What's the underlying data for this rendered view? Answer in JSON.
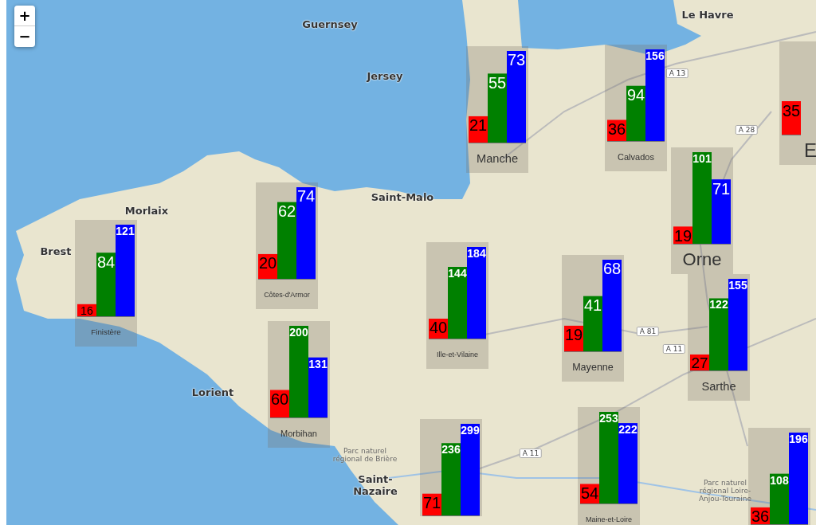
{
  "zoom_controls": [
    {
      "label": "+"
    },
    {
      "label": "−"
    }
  ],
  "places": [
    {
      "kind": "city",
      "name": "Guernsey"
    },
    {
      "kind": "city",
      "name": "Jersey"
    },
    {
      "kind": "city",
      "name": "Le Havre"
    },
    {
      "kind": "city",
      "name": "Saint-Malo"
    },
    {
      "kind": "city",
      "name": "Morlaix"
    },
    {
      "kind": "city",
      "name": "Brest"
    },
    {
      "kind": "city",
      "name": "Lorient"
    },
    {
      "kind": "park",
      "name": "Parc naturel régional de Brière"
    },
    {
      "kind": "city",
      "name": "Saint-Nazaire"
    },
    {
      "kind": "park",
      "name": "Parc naturel régional Loire-Anjou-Touraine"
    },
    {
      "kind": "road",
      "name": "A 13"
    },
    {
      "kind": "road",
      "name": "A 28"
    },
    {
      "kind": "road",
      "name": "A 81"
    },
    {
      "kind": "road",
      "name": "A 11"
    },
    {
      "kind": "road",
      "name": "A 11"
    }
  ],
  "markers": [
    {
      "label": "Manche",
      "chart_data": {
        "type": "bar",
        "categories": [
          null
        ],
        "data_labels": true,
        "series": [
          {
            "color": "#ff0000",
            "values": [
              21
            ]
          },
          {
            "color": "#008000",
            "values": [
              55
            ]
          },
          {
            "color": "#0000ff",
            "values": [
              73
            ]
          }
        ]
      }
    },
    {
      "label": "Calvados",
      "chart_data": {
        "type": "bar",
        "categories": [
          null
        ],
        "data_labels": true,
        "series": [
          {
            "color": "#ff0000",
            "values": [
              36
            ]
          },
          {
            "color": "#008000",
            "values": [
              94
            ]
          },
          {
            "color": "#0000ff",
            "values": [
              156
            ]
          }
        ]
      }
    },
    {
      "label": "E",
      "partial_bar": {
        "value": "35",
        "color": "#ff0000"
      }
    },
    {
      "label": "Orne",
      "chart_data": {
        "type": "bar",
        "categories": [
          null
        ],
        "data_labels": true,
        "series": [
          {
            "color": "#ff0000",
            "values": [
              19
            ]
          },
          {
            "color": "#008000",
            "values": [
              101
            ]
          },
          {
            "color": "#0000ff",
            "values": [
              71
            ]
          }
        ]
      }
    },
    {
      "label": "Côtes-d'Armor",
      "chart_data": {
        "type": "bar",
        "categories": [
          null
        ],
        "data_labels": true,
        "series": [
          {
            "color": "#ff0000",
            "values": [
              20
            ]
          },
          {
            "color": "#008000",
            "values": [
              62
            ]
          },
          {
            "color": "#0000ff",
            "values": [
              74
            ]
          }
        ]
      }
    },
    {
      "label": "Finistère",
      "chart_data": {
        "type": "bar",
        "categories": [
          null
        ],
        "data_labels": true,
        "series": [
          {
            "color": "#ff0000",
            "values": [
              16
            ]
          },
          {
            "color": "#008000",
            "values": [
              84
            ]
          },
          {
            "color": "#0000ff",
            "values": [
              121
            ]
          }
        ]
      }
    },
    {
      "label": "Ille-et-Vilaine",
      "chart_data": {
        "type": "bar",
        "categories": [
          null
        ],
        "data_labels": true,
        "series": [
          {
            "color": "#ff0000",
            "values": [
              40
            ]
          },
          {
            "color": "#008000",
            "values": [
              144
            ]
          },
          {
            "color": "#0000ff",
            "values": [
              184
            ]
          }
        ]
      }
    },
    {
      "label": "Mayenne",
      "chart_data": {
        "type": "bar",
        "categories": [
          null
        ],
        "data_labels": true,
        "series": [
          {
            "color": "#ff0000",
            "values": [
              19
            ]
          },
          {
            "color": "#008000",
            "values": [
              41
            ]
          },
          {
            "color": "#0000ff",
            "values": [
              68
            ]
          }
        ]
      }
    },
    {
      "label": "Sarthe",
      "chart_data": {
        "type": "bar",
        "categories": [
          null
        ],
        "data_labels": true,
        "series": [
          {
            "color": "#ff0000",
            "values": [
              27
            ]
          },
          {
            "color": "#008000",
            "values": [
              122
            ]
          },
          {
            "color": "#0000ff",
            "values": [
              155
            ]
          }
        ]
      }
    },
    {
      "label": "Morbihan",
      "chart_data": {
        "type": "bar",
        "categories": [
          null
        ],
        "data_labels": true,
        "series": [
          {
            "color": "#ff0000",
            "values": [
              60
            ]
          },
          {
            "color": "#008000",
            "values": [
              200
            ]
          },
          {
            "color": "#0000ff",
            "values": [
              131
            ]
          }
        ]
      }
    },
    {
      "label": "Maine-et-Loire",
      "chart_data": {
        "type": "bar",
        "categories": [
          null
        ],
        "data_labels": true,
        "series": [
          {
            "color": "#ff0000",
            "values": [
              54
            ]
          },
          {
            "color": "#008000",
            "values": [
              253
            ]
          },
          {
            "color": "#0000ff",
            "values": [
              222
            ]
          }
        ]
      }
    },
    {
      "chart_data": {
        "type": "bar",
        "categories": [
          null
        ],
        "data_labels": true,
        "series": [
          {
            "color": "#ff0000",
            "values": [
              71
            ]
          },
          {
            "color": "#008000",
            "values": [
              236
            ]
          },
          {
            "color": "#0000ff",
            "values": [
              299
            ]
          }
        ]
      }
    },
    {
      "chart_data": {
        "type": "bar",
        "categories": [
          null
        ],
        "data_labels": true,
        "series": [
          {
            "color": "#ff0000",
            "values": [
              36
            ]
          },
          {
            "color": "#008000",
            "values": [
              108
            ]
          },
          {
            "color": "#0000ff",
            "values": [
              196
            ]
          }
        ]
      }
    }
  ]
}
